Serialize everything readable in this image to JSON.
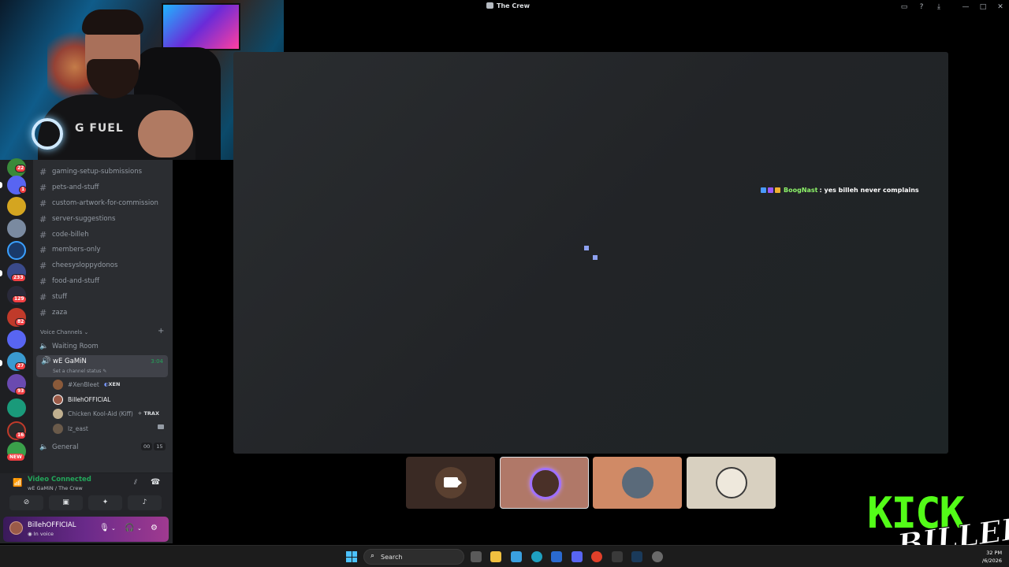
{
  "window": {
    "title": "The Crew"
  },
  "channels": [
    "gaming-setup-submissions",
    "pets-and-stuff",
    "custom-artwork-for-commission",
    "server-suggestions",
    "code-billeh",
    "members-only",
    "cheesysloppydonos",
    "food-and-stuff",
    "stuff",
    "zaza"
  ],
  "voice_section": {
    "label": "Voice Channels",
    "add": "+"
  },
  "voice_channels": {
    "waiting_room": "Waiting Room",
    "active": {
      "name": "wE GaMiN",
      "status": "Set a channel status",
      "timer": "3:04"
    },
    "general": {
      "name": "General",
      "count_a": "00",
      "count_b": "15"
    }
  },
  "members": [
    {
      "name": "#XenBleet",
      "tag": "XEN"
    },
    {
      "name": "BillehOFFICIAL",
      "tag": ""
    },
    {
      "name": "Chicken Kool-Aid (Kiff)",
      "tag": "TRAX"
    },
    {
      "name": "lz_east",
      "tag": ""
    }
  ],
  "guild_badges": [
    "22",
    "1",
    "233",
    "129",
    "82",
    "27",
    "93",
    "16"
  ],
  "new_badge": "NEW",
  "voice_panel": {
    "title": "Video Connected",
    "subtitle": "wE GaMiN / The Crew"
  },
  "user_panel": {
    "name": "BillehOFFICIAL",
    "status": "In voice"
  },
  "chat_overlay": {
    "user": "BoogNast",
    "message": ": yes billeh never complains"
  },
  "taskbar": {
    "search_label": "Search",
    "clock_time": "32 PM",
    "clock_date": "/6/2026"
  },
  "overlay_logo": {
    "kick": "KICK",
    "signature": "BILLEH"
  },
  "colors": {
    "accent_green": "#23a55a",
    "kick_green": "#53fc18",
    "loader": "#8ea1f0"
  }
}
